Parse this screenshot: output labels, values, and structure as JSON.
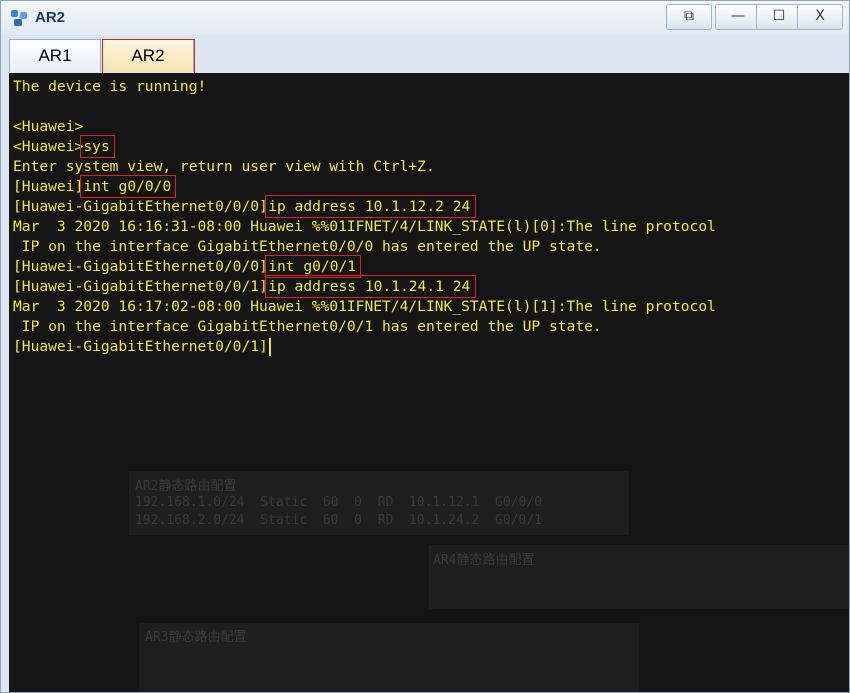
{
  "window": {
    "title": "AR2"
  },
  "window_buttons": {
    "restore": "⧉",
    "minimize": "—",
    "maximize": "☐",
    "close": "X"
  },
  "tabs": [
    {
      "label": "AR1"
    },
    {
      "label": "AR2"
    }
  ],
  "terminal": {
    "lines": [
      {
        "text": "The device is running!"
      },
      {
        "text": ""
      },
      {
        "text": "<Huawei>"
      },
      {
        "prompt": "<Huawei>",
        "cmd": "sys"
      },
      {
        "text": "Enter system view, return user view with Ctrl+Z."
      },
      {
        "prompt": "[Huawei]",
        "cmd": "int g0/0/0"
      },
      {
        "prompt": "[Huawei-GigabitEthernet0/0/0]",
        "cmd": "ip address 10.1.12.2 24"
      },
      {
        "text": "Mar  3 2020 16:16:31-08:00 Huawei %%01IFNET/4/LINK_STATE(l)[0]:The line protocol"
      },
      {
        "text": " IP on the interface GigabitEthernet0/0/0 has entered the UP state."
      },
      {
        "prompt": "[Huawei-GigabitEthernet0/0/0]",
        "cmd": "int g0/0/1"
      },
      {
        "prompt": "[Huawei-GigabitEthernet0/0/1]",
        "cmd": "ip address 10.1.24.1 24"
      },
      {
        "text": "Mar  3 2020 16:17:02-08:00 Huawei %%01IFNET/4/LINK_STATE(l)[1]:The line protocol"
      },
      {
        "text": " IP on the interface GigabitEthernet0/0/1 has entered the UP state."
      },
      {
        "text": "[Huawei-GigabitEthernet0/0/1]"
      }
    ]
  },
  "background": {
    "ar2_table_title": "AR2静态路由配置",
    "ar2_rows": [
      "192.168.1.0/24  Static  60  0  RD  10.1.12.1  G0/0/0",
      "192.168.2.0/24  Static  60  0  RD  10.1.24.2  G0/0/1"
    ],
    "ar4_table_title": "AR4静态路由配置",
    "ar3_table_title": "AR3静态路由配置"
  },
  "colors": {
    "terminal_bg": "#151515",
    "terminal_text": "#f2ea3a",
    "highlight": "#e02020"
  }
}
